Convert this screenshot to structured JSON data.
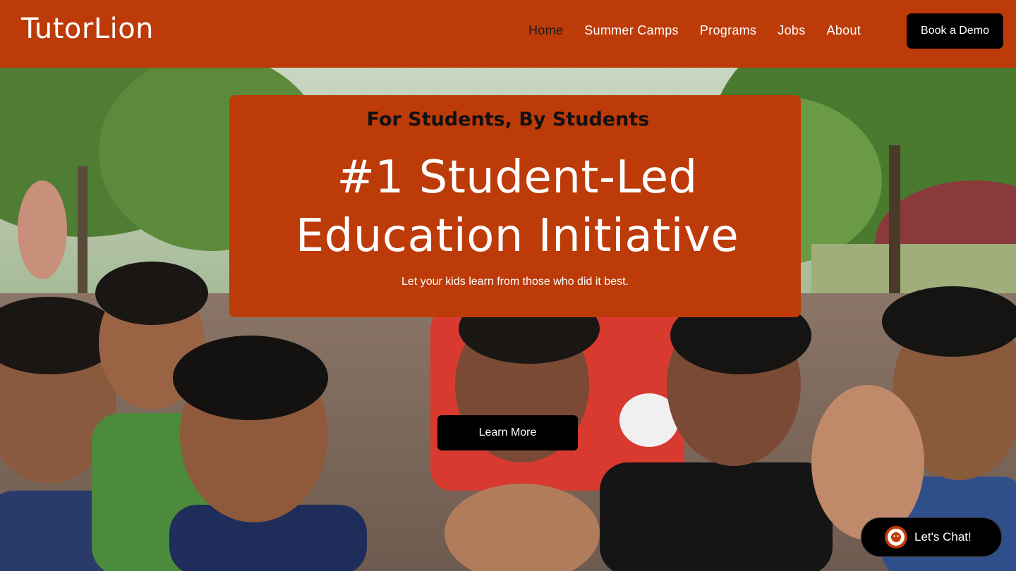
{
  "header": {
    "logo": "TutorLion",
    "nav": [
      {
        "label": "Home",
        "active": true
      },
      {
        "label": "Summer Camps",
        "active": false
      },
      {
        "label": "Programs",
        "active": false
      },
      {
        "label": "Jobs",
        "active": false
      },
      {
        "label": "About",
        "active": false
      }
    ],
    "cta_label": "Book a Demo"
  },
  "hero": {
    "eyebrow": "For Students, By Students",
    "headline_line1": "#1 Student-Led",
    "headline_line2": "Education Initiative",
    "subline": "Let your kids learn from those who did it best.",
    "button_label": "Learn More"
  },
  "chat": {
    "label": "Let's Chat!",
    "icon": "lion-avatar-icon"
  },
  "colors": {
    "brand": "#BD3B08",
    "button": "#000000"
  }
}
